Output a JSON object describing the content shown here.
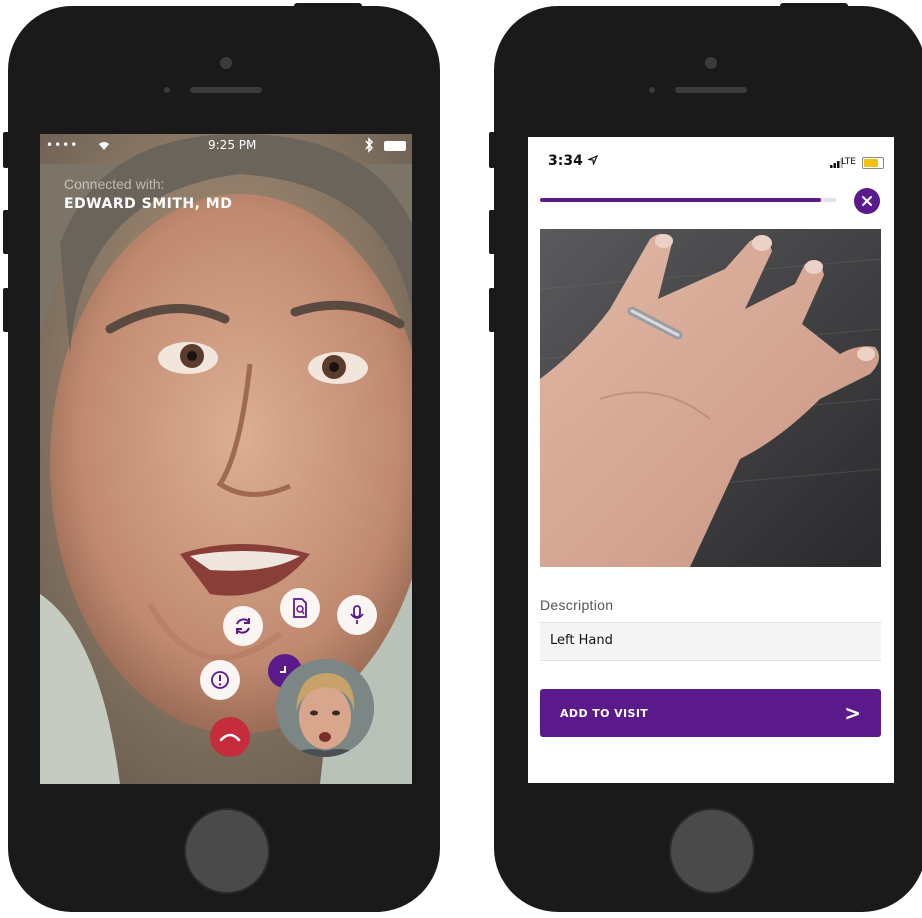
{
  "colors": {
    "accent": "#5a1a8c",
    "end_call": "#c52c3c",
    "phone_body": "#1a1a1a"
  },
  "left_phone": {
    "status_bar": {
      "carrier": "••••",
      "wifi_icon": "wifi-icon",
      "time": "9:25 PM",
      "bluetooth_icon": "bluetooth-icon",
      "battery_icon": "battery-icon"
    },
    "connected_label": "Connected with:",
    "doctor_name": "EDWARD SMITH, MD",
    "controls": [
      {
        "name": "switch-camera-button",
        "icon": "refresh-icon"
      },
      {
        "name": "document-button",
        "icon": "document-icon"
      },
      {
        "name": "microphone-button",
        "icon": "microphone-icon"
      },
      {
        "name": "alert-button",
        "icon": "alert-icon"
      },
      {
        "name": "timer-button",
        "icon": "clock-icon"
      },
      {
        "name": "end-call-button",
        "icon": "hang-up-icon"
      }
    ],
    "self_view_icon": "self-view-video"
  },
  "right_phone": {
    "status_bar": {
      "time": "3:34",
      "location_icon": "location-arrow-icon",
      "signal_icon": "signal-icon",
      "network": "LTE",
      "battery_icon": "battery-icon"
    },
    "progress": 0.95,
    "close_icon": "close-icon",
    "photo_icon": "hand-photo",
    "description_label": "Description",
    "description_value": "Left Hand",
    "add_button_label": "ADD TO VISIT",
    "add_button_arrow": ">"
  }
}
